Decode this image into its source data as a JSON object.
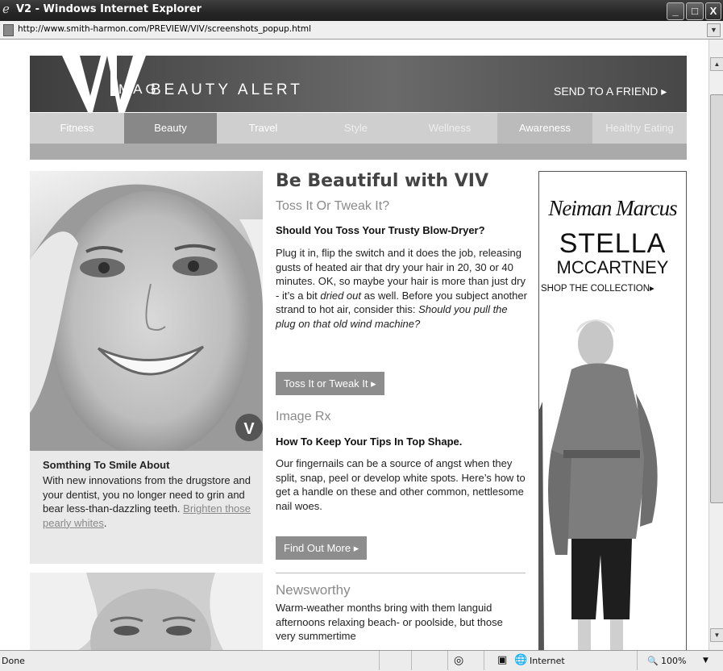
{
  "window": {
    "title": "V2 - Windows Internet Explorer",
    "url": "http://www.smith-harmon.com/PREVIEW/VIV/screenshots_popup.html",
    "minimize_symbol": "_",
    "maximize_symbol": "□",
    "close_symbol": "X"
  },
  "header": {
    "logo_text": "VIV",
    "mag_text": "MAG",
    "brand_text": "BEAUTY ALERT",
    "send_friend": "SEND TO A FRIEND ▸"
  },
  "nav": {
    "items": [
      "Fitness",
      "Beauty",
      "Travel",
      "Style",
      "Wellness",
      "Awareness",
      "Healthy Eating"
    ],
    "active": "Beauty"
  },
  "left": {
    "feature_heading": "Somthing To Smile About",
    "feature_body": "With new innovations from the drugstore and your dentist, you no longer need to grin and bear less-than-dazzling teeth.",
    "feature_link": "Brighten those pearly whites",
    "feature_link_suffix": "."
  },
  "main": {
    "title": "Be Beautiful with VIV",
    "article1": {
      "section": "Toss It Or Tweak It?",
      "headline": "Should You Toss Your Trusty Blow-Dryer?",
      "body_a": "Plug it in, flip the switch and it does the job, releasing gusts of heated air that dry your hair in 20, 30 or 40 minutes. OK, so maybe your hair is more than just dry - it’s a bit",
      "body_em1": "dried out",
      "body_b": "as well. Before you subject another strand to hot air, consider this:",
      "body_em2": "Should you pull the plug on that old wind machine?",
      "button": "Toss It or Tweak It ▸"
    },
    "article2": {
      "section": "Image Rx",
      "headline": "How To Keep Your Tips In Top Shape.",
      "body": "Our fingernails can be a source of angst when they split, snap, peel or develop white spots. Here’s how to get a handle on these and other common, nettlesome nail woes.",
      "button": "Find Out More ▸"
    },
    "article3": {
      "section": "Newsworthy",
      "body": "Warm-weather months bring with them languid afternoons relaxing beach- or poolside, but those very summertime"
    }
  },
  "ad": {
    "store": "Neiman Marcus",
    "designer_line1": "STELLA",
    "designer_line2": "MCCARTNEY",
    "cta": "SHOP THE COLLECTION▸"
  },
  "status": {
    "text": "Done",
    "zone": "Internet",
    "zoom": "100%"
  }
}
